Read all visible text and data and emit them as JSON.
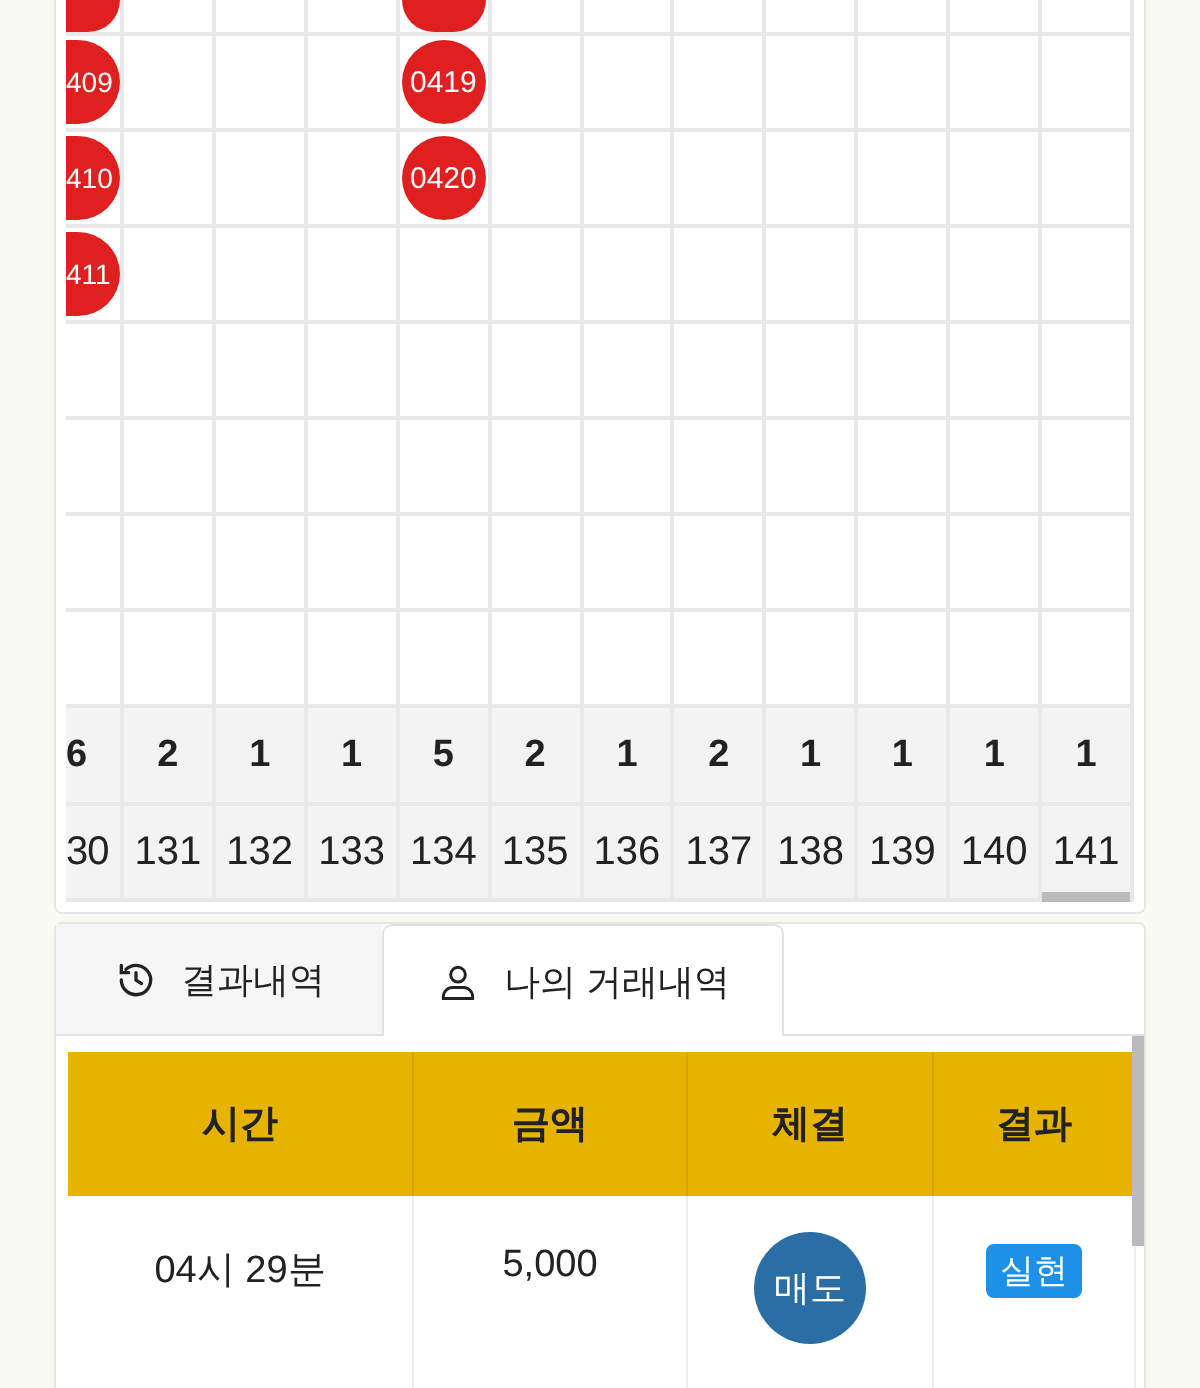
{
  "bead_road": {
    "columns": [
      {
        "partial": true,
        "count": "6",
        "number": "30",
        "beads": [
          {
            "cut_top": true
          },
          {
            "cut_top": false,
            "label": "409"
          },
          {
            "cut_top": false,
            "label": "410"
          },
          {
            "cut_top": false,
            "label": "411"
          }
        ]
      },
      {
        "partial": false,
        "count": "2",
        "number": "131"
      },
      {
        "partial": false,
        "count": "1",
        "number": "132"
      },
      {
        "partial": false,
        "count": "1",
        "number": "133"
      },
      {
        "partial": false,
        "count": "5",
        "number": "134",
        "beads": [
          {
            "cut_top": true
          },
          {
            "cut_top": false,
            "label": "0419"
          },
          {
            "cut_top": false,
            "label": "0420"
          }
        ]
      },
      {
        "partial": false,
        "count": "2",
        "number": "135"
      },
      {
        "partial": false,
        "count": "1",
        "number": "136"
      },
      {
        "partial": false,
        "count": "2",
        "number": "137"
      },
      {
        "partial": false,
        "count": "1",
        "number": "138"
      },
      {
        "partial": false,
        "count": "1",
        "number": "139"
      },
      {
        "partial": false,
        "count": "1",
        "number": "140"
      },
      {
        "partial": false,
        "count": "1",
        "number": "141"
      }
    ]
  },
  "tabs": [
    {
      "label": "결과내역",
      "selected": false
    },
    {
      "label": "나의 거래내역",
      "selected": true
    }
  ],
  "table": {
    "columns": [
      "시간",
      "금액",
      "체결",
      "결과"
    ],
    "rows": [
      {
        "time": "04시 29분",
        "amount": "5,000",
        "trade": "매도",
        "result": "실현"
      }
    ]
  }
}
